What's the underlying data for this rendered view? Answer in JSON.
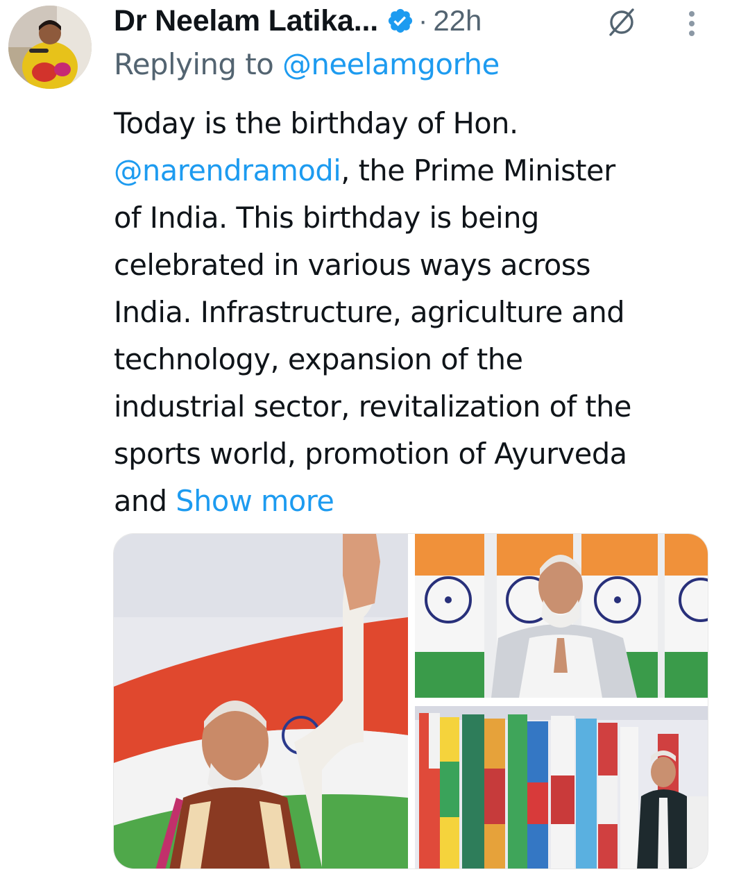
{
  "tweet": {
    "author_name": "Dr Neelam Latika...",
    "separator": "·",
    "timestamp": "22h",
    "reply_prefix": "Replying to",
    "reply_handle": "@neelamgorhe",
    "text_lines": [
      "Today is the birthday of Hon.",
      ", the Prime Minister",
      "of India. This birthday is being",
      "celebrated in various ways across",
      "India. Infrastructure, agriculture and",
      "technology, expansion of the",
      "industrial sector, revitalization of the",
      "sports world, promotion of Ayurveda",
      "and "
    ],
    "mention_in_text": "@narendramodi",
    "show_more_label": "Show more"
  },
  "icons": {
    "verified": "verified-badge-icon",
    "grok": "grok-icon",
    "more": "more-options-icon"
  },
  "colors": {
    "link": "#1d9bf0",
    "secondary_text": "#536471",
    "primary_text": "#0f1419",
    "verified": "#1d9bf0"
  },
  "media": {
    "count": 3
  }
}
